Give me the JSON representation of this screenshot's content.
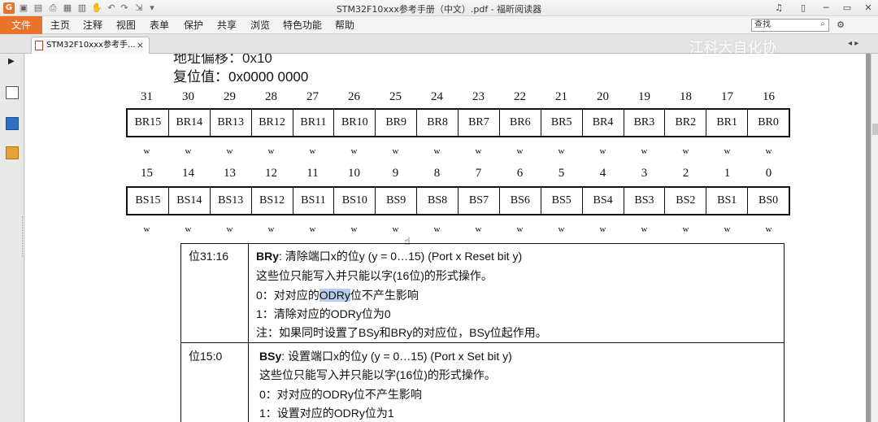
{
  "window": {
    "title": "STM32F10xxx参考手册（中文）.pdf - 福昕阅读器"
  },
  "menu": {
    "file_tab": "文件",
    "items": [
      "主页",
      "注释",
      "视图",
      "表单",
      "保护",
      "共享",
      "浏览",
      "特色功能",
      "帮助"
    ],
    "search_value": "查找"
  },
  "tabs": {
    "doc_tab_label": "STM32F10xxx参考手...",
    "close_glyph": "×"
  },
  "watermark": "江科大自化协",
  "document": {
    "cut_line": "地址偏移：0x10",
    "reset_value": "复位值：0x0000  0000",
    "high_bits": [
      "31",
      "30",
      "29",
      "28",
      "27",
      "26",
      "25",
      "24",
      "23",
      "22",
      "21",
      "20",
      "19",
      "18",
      "17",
      "16"
    ],
    "high_fields": [
      "BR15",
      "BR14",
      "BR13",
      "BR12",
      "BR11",
      "BR10",
      "BR9",
      "BR8",
      "BR7",
      "BR6",
      "BR5",
      "BR4",
      "BR3",
      "BR2",
      "BR1",
      "BR0"
    ],
    "low_bits": [
      "15",
      "14",
      "13",
      "12",
      "11",
      "10",
      "9",
      "8",
      "7",
      "6",
      "5",
      "4",
      "3",
      "2",
      "1",
      "0"
    ],
    "low_fields": [
      "BS15",
      "BS14",
      "BS13",
      "BS12",
      "BS11",
      "BS10",
      "BS9",
      "BS8",
      "BS7",
      "BS6",
      "BS5",
      "BS4",
      "BS3",
      "BS2",
      "BS1",
      "BS0"
    ],
    "access": "w",
    "desc": [
      {
        "range": "位31:16",
        "name": "BRy",
        "title_rest": ": 清除端口x的位y (y = 0…15) (Port x Reset bit y)",
        "line1": "这些位只能写入并只能以字(16位)的形式操作。",
        "line2_pre": "0：对对应的",
        "line2_highlight": "ODRy",
        "line2_post": "位不产生影响",
        "line3": "1：清除对应的ODRy位为0",
        "line4": "注：如果同时设置了BSy和BRy的对应位，BSy位起作用。"
      },
      {
        "range": "位15:0",
        "name": "BSy",
        "title_rest": ": 设置端口x的位y (y = 0…15) (Port x Set bit y)",
        "line1": "这些位只能写入并只能以字(16位)的形式操作。",
        "line2": "0：对对应的ODRy位不产生影响",
        "line3": "1：设置对应的ODRy位为1"
      }
    ]
  }
}
